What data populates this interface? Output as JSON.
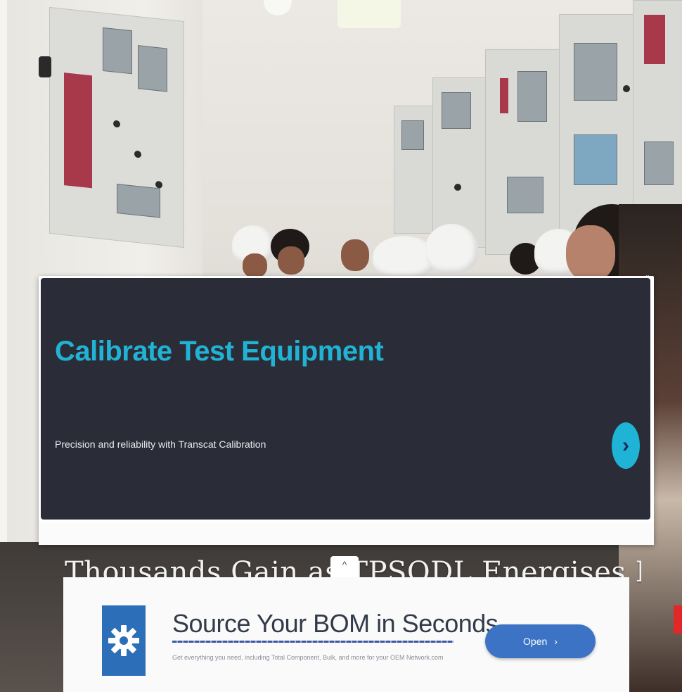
{
  "promo": {
    "title": "Calibrate Test Equipment",
    "subtitle": "Precision and reliability with Transcat Calibration",
    "next_glyph": "›",
    "footer_left": "",
    "footer_right": "",
    "close_glyph": "×"
  },
  "headline": {
    "text": "Thousands Gain as TPSODL Energises Berhampur"
  },
  "ad": {
    "collapse_glyph": "^",
    "close_glyph": "",
    "title": "Source Your BOM in Seconds",
    "description": "Get everything you need, including Total Component, Bulk, and more for your OEM Network.com",
    "button_label": "Open",
    "button_glyph": "›",
    "icon": "gear-icon"
  },
  "colors": {
    "promo_bg": "#2a2d38",
    "promo_title": "#21b3d4",
    "accent_button": "#1fb3d6",
    "ad_button": "#3c73c4",
    "ad_icon_bg": "#2c6fb8"
  }
}
